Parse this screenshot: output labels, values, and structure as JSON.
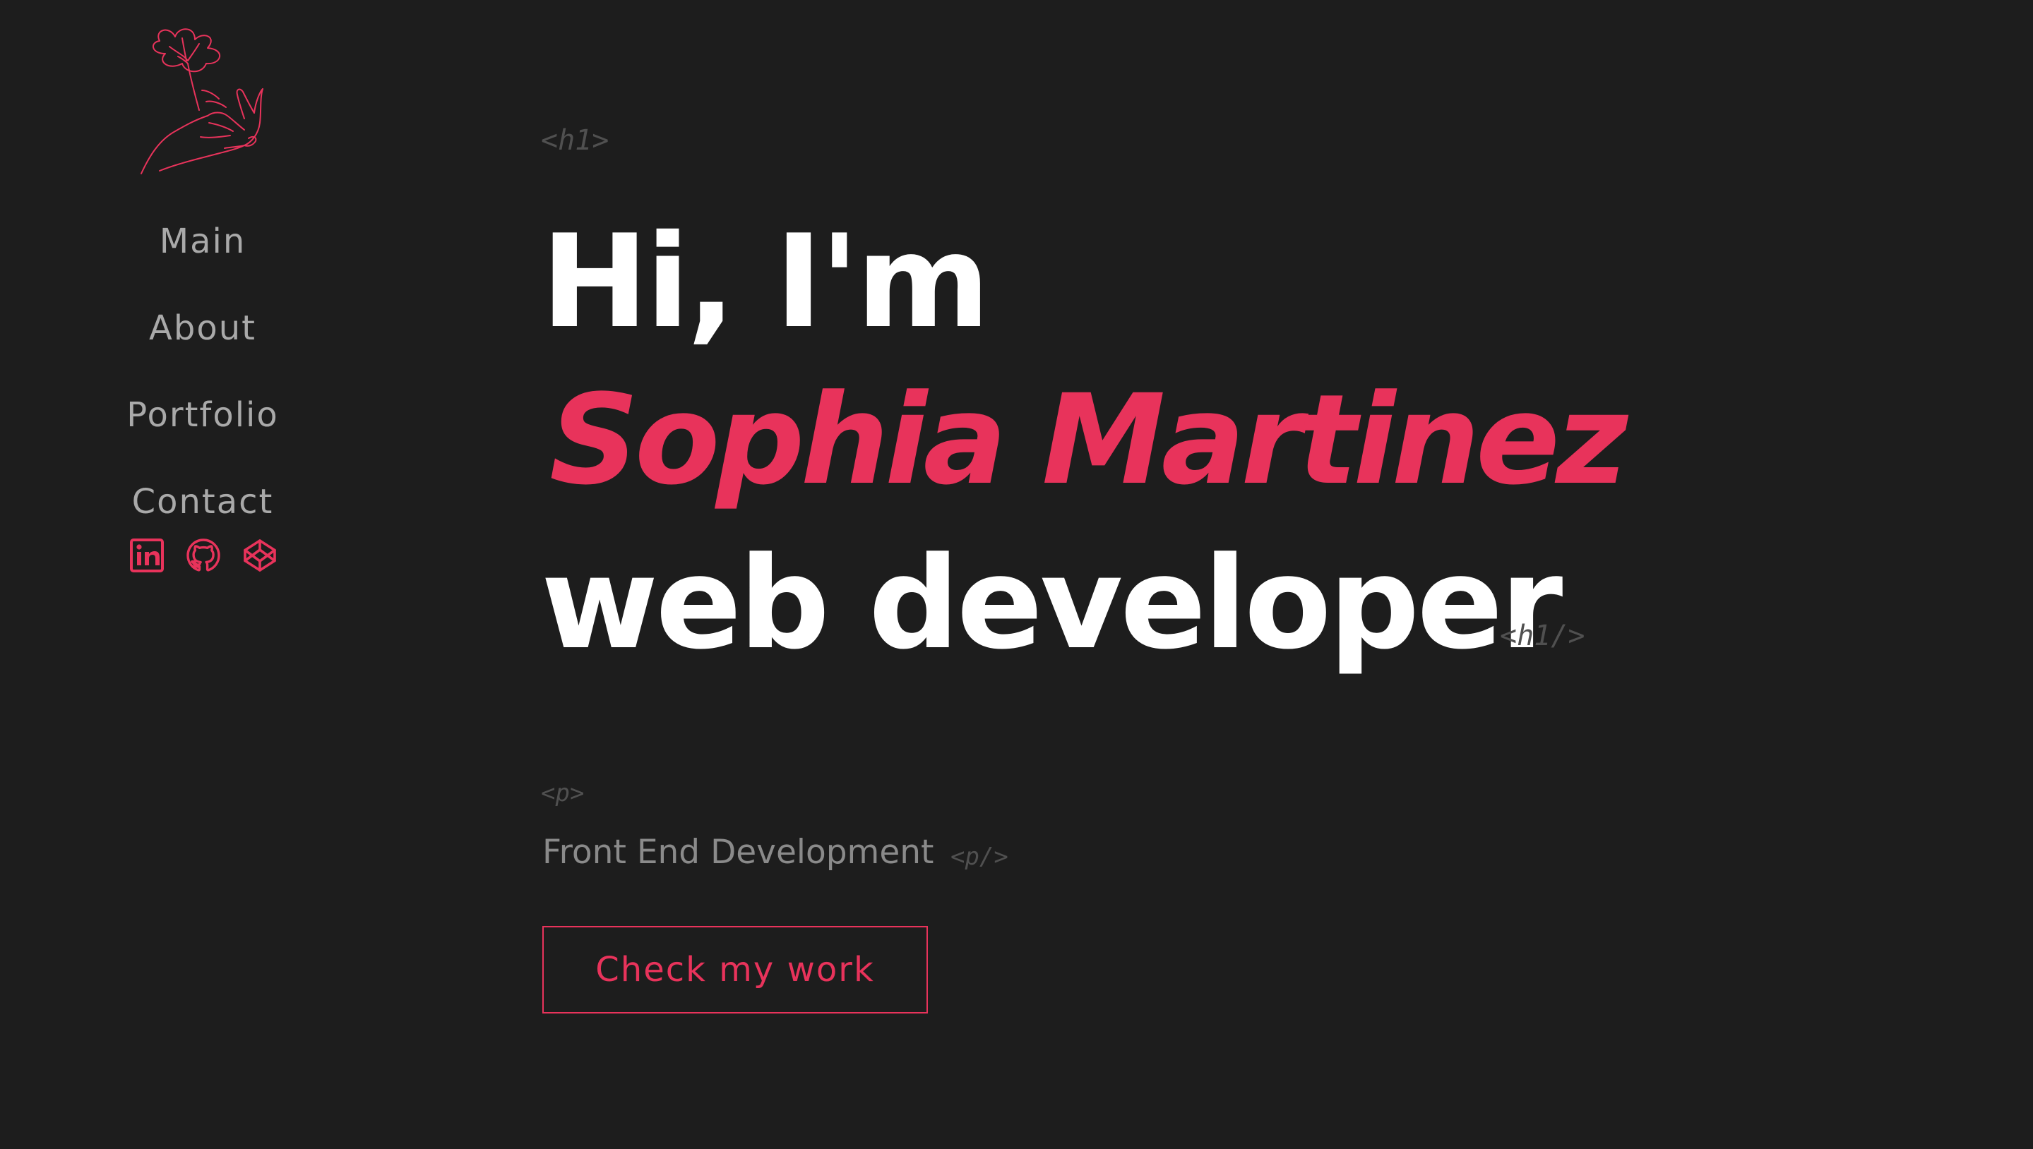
{
  "colors": {
    "background": "#1d1d1d",
    "accent": "#e8335b",
    "nav_text": "#a9a9a9",
    "heading": "#ffffff",
    "tag": "#505050",
    "subtitle": "#8a8a8a"
  },
  "sidebar": {
    "logo_icon": "flower-in-hand-icon",
    "nav": [
      {
        "label": "Main"
      },
      {
        "label": "About"
      },
      {
        "label": "Portfolio"
      },
      {
        "label": "Contact"
      }
    ],
    "social": [
      {
        "icon": "linkedin-icon"
      },
      {
        "icon": "github-icon"
      },
      {
        "icon": "codepen-icon"
      }
    ]
  },
  "hero": {
    "h1_open_tag": "<h1>",
    "greeting": "Hi, I'm",
    "name": "Sophia Martinez",
    "role": "web developer",
    "h1_close_tag": "<h1/>",
    "p_open_tag": "<p>",
    "subtitle": "Front End Development",
    "p_close_tag": "<p/>",
    "cta_label": "Check my work"
  }
}
